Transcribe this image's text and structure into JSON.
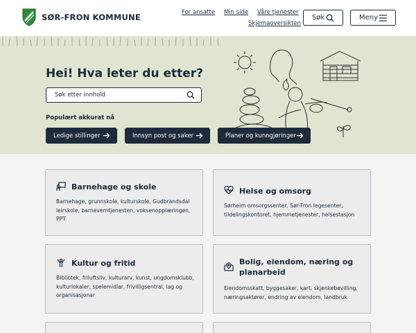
{
  "header": {
    "logo_text": "SØR-FRON KOMMUNE",
    "links": [
      "For ansatte",
      "Min side",
      "Våre tjenester",
      "Skjemaoversikten"
    ],
    "search_button": "Søk",
    "menu_button": "Meny"
  },
  "hero": {
    "title": "Hei! Hva leter du etter?",
    "search_placeholder": "Søk etter innhold",
    "popular_label": "Populært akkurat nå",
    "quick_links": [
      "Ledige stillinger",
      "Innsyn post og saker",
      "Planer og kunngjøringer"
    ],
    "background_color": "#dfe5d1"
  },
  "cards": [
    {
      "title": "Barnehage og skole",
      "desc": "Barnehage, grunnskole, kulturskole, Gudbrandsdal leirskole, barneverntjenesten, voksenopplæringen, PPT",
      "icon": "classroom-icon"
    },
    {
      "title": "Helse og omsorg",
      "desc": "Sørheim omsorgssenter, Sør-Fron legesenter, tildelingskontoret, hjemmetjenester, helsestasjon",
      "icon": "heart-pulse-icon"
    },
    {
      "title": "Kultur og fritid",
      "desc": "Bibliotek, friluftsliv, kulturarv, kunst, ungdomsklubb, kulturlokaler, spelemidlar, frivilligsentral, lag og organisasjonar",
      "icon": "person-celebrate-icon"
    },
    {
      "title": "Bolig, eiendom, næring og planarbeid",
      "desc": "Eiendomsskatt, byggesaker, kart, skjenkebevilling, næringsaktører, endring av eiendom, landbruk",
      "icon": "map-location-icon"
    }
  ],
  "colors": {
    "navy": "#1e2b3c",
    "logo_green": "#2e8b3a",
    "card_background": "#ececec",
    "page_background": "#f4f4f4"
  }
}
